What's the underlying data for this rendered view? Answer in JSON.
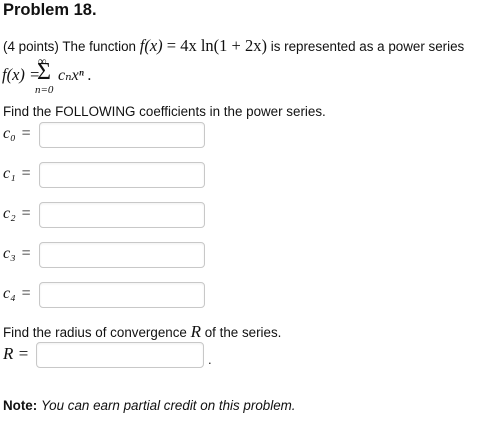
{
  "problem": {
    "title": "Problem 18.",
    "points": "(4 points)",
    "intro_text": "The function",
    "function_lhs": "f(x)",
    "function_eq": " = ",
    "function_rhs": "4x ln(1 + 2x)",
    "intro_tail": "is represented as a power series"
  },
  "series": {
    "lhs": "f(x) = ",
    "upper": "∞",
    "sigma": "Σ",
    "term": "cₙxⁿ .",
    "lower": "n=0"
  },
  "coefficients_prompt": "Find the FOLLOWING coefficients in the power series.",
  "coefficients": [
    {
      "label": "c₀",
      "eq": "=",
      "value": ""
    },
    {
      "label": "c₁",
      "eq": "=",
      "value": ""
    },
    {
      "label": "c₂",
      "eq": "=",
      "value": ""
    },
    {
      "label": "c₃",
      "eq": "=",
      "value": ""
    },
    {
      "label": "c₄",
      "eq": "=",
      "value": ""
    }
  ],
  "radius": {
    "prompt_before": "Find the radius of convergence",
    "symbol": "R",
    "prompt_after": "of the series.",
    "label": "R =",
    "value": "",
    "period": "."
  },
  "note": {
    "label": "Note:",
    "text": "You can earn partial credit on this problem."
  }
}
